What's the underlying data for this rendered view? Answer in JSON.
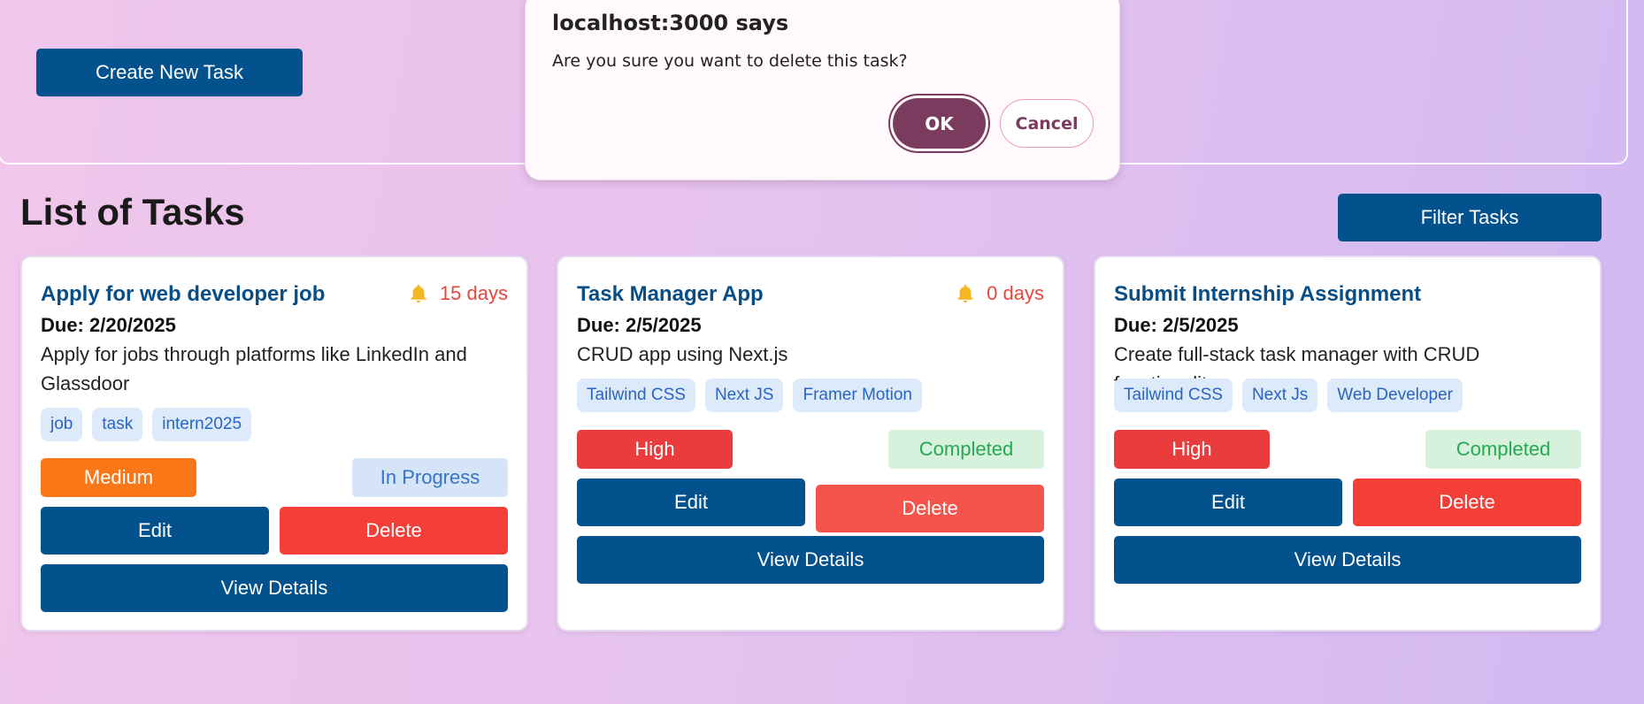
{
  "header": {
    "create_label": "Create New Task"
  },
  "list": {
    "title": "List of Tasks",
    "filter_label": "Filter Tasks"
  },
  "tasks": [
    {
      "title": "Apply for web developer job",
      "reminder": "15 days",
      "due": "Due: 2/20/2025",
      "description": "Apply for jobs through platforms like LinkedIn and Glassdoor",
      "tags": [
        "job",
        "task",
        "intern2025"
      ],
      "priority": "Medium",
      "status": "In Progress",
      "edit_label": "Edit",
      "delete_label": "Delete",
      "view_label": "View Details"
    },
    {
      "title": "Task Manager App",
      "reminder": "0 days",
      "due": "Due: 2/5/2025",
      "description": "CRUD app using Next.js",
      "tags": [
        "Tailwind CSS",
        "Next JS",
        "Framer Motion"
      ],
      "priority": "High",
      "status": "Completed",
      "edit_label": "Edit",
      "delete_label": "Delete",
      "view_label": "View Details"
    },
    {
      "title": "Submit Internship Assignment",
      "due": "Due: 2/5/2025",
      "description": "Create full-stack task manager with CRUD functionality",
      "tags": [
        "Tailwind CSS",
        "Next Js",
        "Web Developer"
      ],
      "priority": "High",
      "status": "Completed",
      "edit_label": "Edit",
      "delete_label": "Delete",
      "view_label": "View Details"
    }
  ],
  "dialog": {
    "title": "localhost:3000 says",
    "message": "Are you sure you want to delete this task?",
    "ok_label": "OK",
    "cancel_label": "Cancel"
  },
  "colors": {
    "primary": "#03528e",
    "danger": "#f43f38",
    "medium": "#f97717",
    "accent": "#7b3b5e"
  },
  "icons": {
    "reminder": "bell-icon"
  }
}
